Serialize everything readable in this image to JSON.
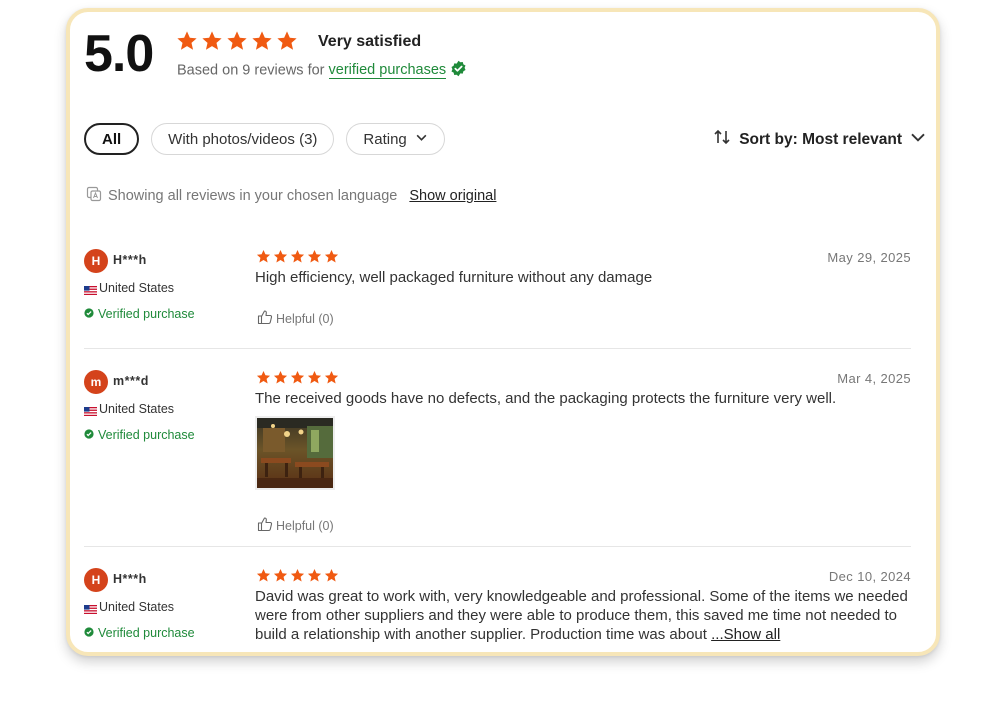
{
  "summary": {
    "score": "5.0",
    "satisfaction": "Very satisfied",
    "based_on": "Based on 9 reviews for",
    "verified_purchases": "verified purchases",
    "star_count": 5,
    "rating": 5
  },
  "filters": {
    "all": "All",
    "with_media": "With photos/videos (3)",
    "rating": "Rating"
  },
  "sort": {
    "label": "Sort by: Most relevant"
  },
  "language": {
    "notice": "Showing all reviews in your chosen language",
    "show_original": "Show original"
  },
  "colors": {
    "star": "#f05a12",
    "verified": "#1f8a3a",
    "avatar": "#d4431b"
  },
  "reviews": [
    {
      "initial": "H",
      "name": "H***h",
      "country": "United States",
      "verified": "Verified purchase",
      "rating": 5,
      "date": "May 29, 2025",
      "text": "High efficiency, well packaged furniture without any damage",
      "helpful": "Helpful (0)"
    },
    {
      "initial": "m",
      "name": "m***d",
      "country": "United States",
      "verified": "Verified purchase",
      "rating": 5,
      "date": "Mar 4, 2025",
      "text": "The received goods have no defects, and the packaging protects the furniture very well.",
      "helpful": "Helpful (0)"
    },
    {
      "initial": "H",
      "name": "H***h",
      "country": "United States",
      "verified": "Verified purchase",
      "rating": 5,
      "date": "Dec 10, 2024",
      "text": "David was great to work with, very knowledgeable and professional. Some of the items we needed were from other suppliers and they were able to produce them, this saved me time not needed to build a relationship with another supplier. Production time was about",
      "more": "...Show all"
    }
  ]
}
